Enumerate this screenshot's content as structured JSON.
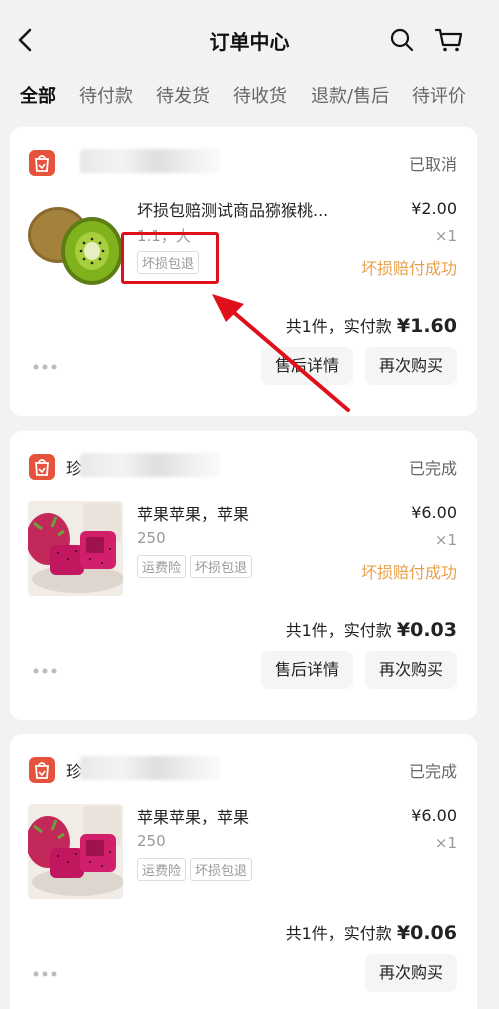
{
  "header": {
    "title": "订单中心",
    "back_icon": "chevron-left-icon",
    "search_icon": "search-icon",
    "cart_icon": "cart-icon"
  },
  "tabs": [
    {
      "label": "全部",
      "active": true
    },
    {
      "label": "待付款",
      "active": false
    },
    {
      "label": "待发货",
      "active": false
    },
    {
      "label": "待收货",
      "active": false
    },
    {
      "label": "退款/售后",
      "active": false
    },
    {
      "label": "待评价",
      "active": false
    }
  ],
  "orders": [
    {
      "shop_prefix": "",
      "status": "已取消",
      "product_name": "坏损包赔测试商品猕猴桃...",
      "spec": "1.1，大",
      "tags": [
        "坏损包退"
      ],
      "price": "¥2.00",
      "qty": "×1",
      "refund_status": "坏损赔付成功",
      "total_prefix": "共1件，实付款",
      "total_amount": "¥1.60",
      "buttons": [
        "售后详情",
        "再次购买"
      ]
    },
    {
      "shop_prefix": "珍",
      "status": "已完成",
      "product_name": "苹果苹果，苹果",
      "spec": "250",
      "tags": [
        "运费险",
        "坏损包退"
      ],
      "price": "¥6.00",
      "qty": "×1",
      "refund_status": "坏损赔付成功",
      "total_prefix": "共1件，实付款",
      "total_amount": "¥0.03",
      "buttons": [
        "售后详情",
        "再次购买"
      ]
    },
    {
      "shop_prefix": "珍",
      "status": "已完成",
      "product_name": "苹果苹果，苹果",
      "spec": "250",
      "tags": [
        "运费险",
        "坏损包退"
      ],
      "price": "¥6.00",
      "qty": "×1",
      "refund_status": "",
      "total_prefix": "共1件，实付款",
      "total_amount": "¥0.06",
      "buttons": [
        "再次购买"
      ]
    }
  ],
  "colors": {
    "accent": "#e8a04c",
    "annotation": "#e0101a",
    "background": "#f2f2f2"
  }
}
